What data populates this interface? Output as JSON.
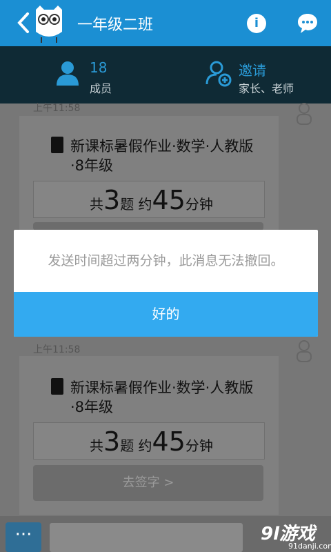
{
  "header": {
    "title": "一年级二班"
  },
  "info_bar": {
    "member_count": "18",
    "member_label": "成员",
    "invite_title": "邀请",
    "invite_sub": "家长、老师"
  },
  "messages": [
    {
      "time": "上午11:58",
      "doc_title": "新课标暑假作业·数学·人教版·8年级",
      "count_prefix": "共",
      "count_value": "3",
      "count_unit": "题",
      "time_prefix": "约",
      "time_value": "45",
      "time_unit": "分钟"
    },
    {
      "time": "上午11:58",
      "doc_title": "新课标暑假作业·数学·人教版·8年级",
      "count_prefix": "共",
      "count_value": "3",
      "count_unit": "题",
      "time_prefix": "约",
      "time_value": "45",
      "time_unit": "分钟",
      "sign_label": "去签字 >"
    }
  ],
  "dialog": {
    "message": "发送时间超过两分钟，此消息无法撤回。",
    "ok_label": "好的"
  },
  "bottom": {
    "more_label": "···"
  },
  "watermark": {
    "logo": "9l游戏",
    "site": "91danji.com"
  },
  "colors": {
    "header_bg": "#1b8fd3",
    "infobar_bg": "#0f2a35",
    "dialog_button": "#33aaf0"
  }
}
